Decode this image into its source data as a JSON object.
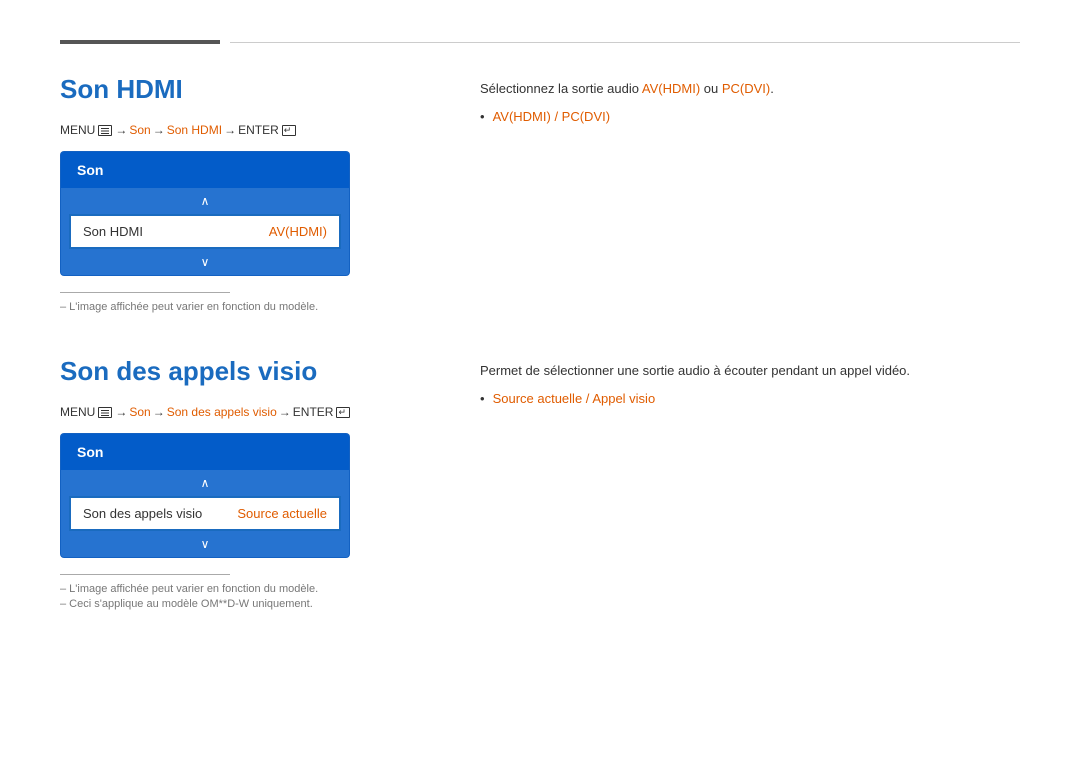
{
  "divider": {},
  "section1": {
    "title": "Son HDMI",
    "menu_path": {
      "prefix": "MENU",
      "parts": [
        "Son",
        "Son HDMI",
        "ENTER"
      ],
      "arrows": [
        "→",
        "→",
        "→"
      ]
    },
    "tv_menu": {
      "header": "Son",
      "item_label": "Son HDMI",
      "item_value": "AV(HDMI)"
    },
    "footnote": "– L'image affichée peut varier en fonction du modèle.",
    "description": "Sélectionnez la sortie audio",
    "description_links": "AV(HDMI) ou PC(DVI).",
    "bullet_text_1": "AV(HDMI)",
    "bullet_separator": " / ",
    "bullet_text_2": "PC(DVI)"
  },
  "section2": {
    "title": "Son des appels visio",
    "menu_path": {
      "prefix": "MENU",
      "parts": [
        "Son",
        "Son des appels visio",
        "ENTER"
      ],
      "arrows": [
        "→",
        "→",
        "→"
      ]
    },
    "tv_menu": {
      "header": "Son",
      "item_label": "Son des appels visio",
      "item_value": "Source actuelle"
    },
    "footnote1": "– L'image affichée peut varier en fonction du modèle.",
    "footnote2": "– Ceci s'applique au modèle OM**D-W uniquement.",
    "description": "Permet de sélectionner une sortie audio à écouter pendant un appel vidéo.",
    "bullet_text_1": "Source actuelle",
    "bullet_separator": " / ",
    "bullet_text_2": "Appel visio"
  }
}
